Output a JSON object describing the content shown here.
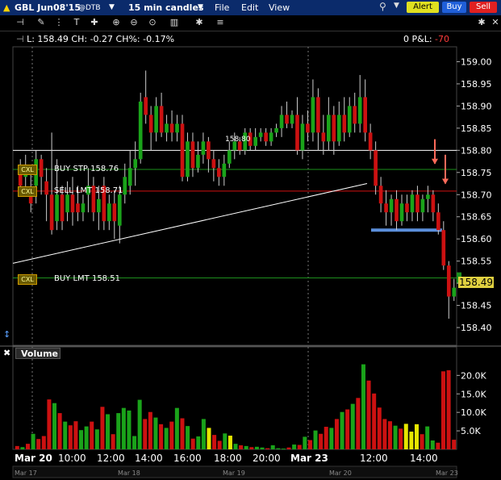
{
  "header": {
    "symbol": "GBL Jun08'15",
    "exchange": "@DTB",
    "timeframe": "15 min candles",
    "menu": [
      "File",
      "Edit",
      "View"
    ],
    "alert_label": "Alert",
    "buy_label": "Buy",
    "sell_label": "Sell"
  },
  "stats": {
    "text": "L: 158.49 CH: -0.27 CH%: -0.17%",
    "pnl_prefix": "0 P&L:",
    "pnl_value": "-70"
  },
  "orders": [
    {
      "tag": "CXL",
      "text": "BUY STP 158.76",
      "price": 158.76
    },
    {
      "tag": "CXL",
      "text": "SELL LMT 158.71",
      "price": 158.71
    },
    {
      "tag": "CXL",
      "text": "BUY LMT 158.51",
      "price": 158.51
    }
  ],
  "midline_label": "158.80",
  "last_price": "158.49",
  "volume_panel": {
    "label": "Volume"
  },
  "colors": {
    "up": "#1aa31a",
    "down": "#cc1111",
    "neutral": "#e6e600",
    "trendline": "#ffffff",
    "support": "#5b8fdc",
    "arrow": "#ff6a5a"
  },
  "chart_data": {
    "type": "candlestick",
    "price_axis": {
      "ticks": [
        "159.00",
        "158.95",
        "158.90",
        "158.85",
        "158.80",
        "158.75",
        "158.70",
        "158.65",
        "158.60",
        "158.55",
        "158.50",
        "158.45",
        "158.40"
      ],
      "ylim": [
        158.36,
        159.03
      ]
    },
    "volume_axis": {
      "ticks": [
        "20.0K",
        "15.0K",
        "10.0K",
        "5.0K"
      ],
      "ylim": [
        0,
        24000
      ]
    },
    "time_labels": [
      "Mar 20",
      "10:00",
      "12:00",
      "14:00",
      "16:00",
      "18:00",
      "20:00",
      "Mar 23",
      "12:00",
      "14:00"
    ],
    "scroll_labels": [
      "Mar 17",
      "Mar 18",
      "Mar 19",
      "Mar 20",
      "Mar 23"
    ],
    "candles": [
      {
        "o": 158.76,
        "c": 158.72,
        "h": 158.78,
        "l": 158.7
      },
      {
        "o": 158.74,
        "c": 158.76,
        "h": 158.79,
        "l": 158.7
      },
      {
        "o": 158.7,
        "c": 158.68,
        "h": 158.75,
        "l": 158.66
      },
      {
        "o": 158.72,
        "c": 158.78,
        "h": 158.8,
        "l": 158.68
      },
      {
        "o": 158.78,
        "c": 158.74,
        "h": 158.79,
        "l": 158.7
      },
      {
        "o": 158.73,
        "c": 158.7,
        "h": 158.76,
        "l": 158.64
      },
      {
        "o": 158.7,
        "c": 158.62,
        "h": 158.84,
        "l": 158.61
      },
      {
        "o": 158.64,
        "c": 158.7,
        "h": 158.78,
        "l": 158.62
      },
      {
        "o": 158.7,
        "c": 158.64,
        "h": 158.72,
        "l": 158.62
      },
      {
        "o": 158.66,
        "c": 158.7,
        "h": 158.73,
        "l": 158.64
      },
      {
        "o": 158.7,
        "c": 158.66,
        "h": 158.74,
        "l": 158.63
      },
      {
        "o": 158.68,
        "c": 158.66,
        "h": 158.72,
        "l": 158.64
      },
      {
        "o": 158.66,
        "c": 158.68,
        "h": 158.7,
        "l": 158.64
      },
      {
        "o": 158.7,
        "c": 158.72,
        "h": 158.76,
        "l": 158.66
      },
      {
        "o": 158.72,
        "c": 158.66,
        "h": 158.74,
        "l": 158.64
      },
      {
        "o": 158.66,
        "c": 158.69,
        "h": 158.72,
        "l": 158.62
      },
      {
        "o": 158.72,
        "c": 158.64,
        "h": 158.74,
        "l": 158.62
      },
      {
        "o": 158.64,
        "c": 158.68,
        "h": 158.7,
        "l": 158.62
      },
      {
        "o": 158.68,
        "c": 158.64,
        "h": 158.71,
        "l": 158.6
      },
      {
        "o": 158.63,
        "c": 158.7,
        "h": 158.72,
        "l": 158.59
      },
      {
        "o": 158.7,
        "c": 158.74,
        "h": 158.77,
        "l": 158.68
      },
      {
        "o": 158.72,
        "c": 158.76,
        "h": 158.8,
        "l": 158.7
      },
      {
        "o": 158.76,
        "c": 158.78,
        "h": 158.82,
        "l": 158.72
      },
      {
        "o": 158.78,
        "c": 158.91,
        "h": 158.93,
        "l": 158.77
      },
      {
        "o": 158.92,
        "c": 158.88,
        "h": 158.98,
        "l": 158.86
      },
      {
        "o": 158.88,
        "c": 158.84,
        "h": 158.9,
        "l": 158.8
      },
      {
        "o": 158.84,
        "c": 158.9,
        "h": 158.92,
        "l": 158.82
      },
      {
        "o": 158.9,
        "c": 158.84,
        "h": 158.93,
        "l": 158.83
      },
      {
        "o": 158.84,
        "c": 158.86,
        "h": 158.88,
        "l": 158.82
      },
      {
        "o": 158.86,
        "c": 158.84,
        "h": 158.89,
        "l": 158.82
      },
      {
        "o": 158.84,
        "c": 158.86,
        "h": 158.88,
        "l": 158.82
      },
      {
        "o": 158.86,
        "c": 158.74,
        "h": 158.88,
        "l": 158.73
      },
      {
        "o": 158.74,
        "c": 158.82,
        "h": 158.84,
        "l": 158.73
      },
      {
        "o": 158.82,
        "c": 158.76,
        "h": 158.84,
        "l": 158.74
      },
      {
        "o": 158.76,
        "c": 158.79,
        "h": 158.82,
        "l": 158.75
      },
      {
        "o": 158.79,
        "c": 158.82,
        "h": 158.84,
        "l": 158.77
      },
      {
        "o": 158.82,
        "c": 158.78,
        "h": 158.83,
        "l": 158.75
      },
      {
        "o": 158.78,
        "c": 158.76,
        "h": 158.8,
        "l": 158.73
      },
      {
        "o": 158.76,
        "c": 158.74,
        "h": 158.78,
        "l": 158.72
      },
      {
        "o": 158.74,
        "c": 158.77,
        "h": 158.79,
        "l": 158.72
      },
      {
        "o": 158.77,
        "c": 158.8,
        "h": 158.82,
        "l": 158.76
      },
      {
        "o": 158.8,
        "c": 158.82,
        "h": 158.84,
        "l": 158.78
      },
      {
        "o": 158.82,
        "c": 158.8,
        "h": 158.83,
        "l": 158.79
      },
      {
        "o": 158.8,
        "c": 158.84,
        "h": 158.85,
        "l": 158.79
      },
      {
        "o": 158.84,
        "c": 158.81,
        "h": 158.85,
        "l": 158.8
      },
      {
        "o": 158.81,
        "c": 158.83,
        "h": 158.85,
        "l": 158.8
      },
      {
        "o": 158.83,
        "c": 158.84,
        "h": 158.85,
        "l": 158.82
      },
      {
        "o": 158.84,
        "c": 158.82,
        "h": 158.85,
        "l": 158.81
      },
      {
        "o": 158.82,
        "c": 158.84,
        "h": 158.85,
        "l": 158.81
      },
      {
        "o": 158.84,
        "c": 158.85,
        "h": 158.86,
        "l": 158.83
      },
      {
        "o": 158.85,
        "c": 158.88,
        "h": 158.9,
        "l": 158.83
      },
      {
        "o": 158.88,
        "c": 158.86,
        "h": 158.91,
        "l": 158.85
      },
      {
        "o": 158.86,
        "c": 158.88,
        "h": 158.89,
        "l": 158.85
      },
      {
        "o": 158.88,
        "c": 158.8,
        "h": 158.92,
        "l": 158.79
      },
      {
        "o": 158.8,
        "c": 158.86,
        "h": 158.88,
        "l": 158.78
      },
      {
        "o": 158.86,
        "c": 158.84,
        "h": 158.89,
        "l": 158.82
      },
      {
        "o": 158.84,
        "c": 158.92,
        "h": 158.96,
        "l": 158.82
      },
      {
        "o": 158.92,
        "c": 158.84,
        "h": 158.94,
        "l": 158.8
      },
      {
        "o": 158.84,
        "c": 158.82,
        "h": 158.88,
        "l": 158.79
      },
      {
        "o": 158.82,
        "c": 158.88,
        "h": 158.92,
        "l": 158.8
      },
      {
        "o": 158.88,
        "c": 158.82,
        "h": 158.9,
        "l": 158.79
      },
      {
        "o": 158.82,
        "c": 158.88,
        "h": 158.91,
        "l": 158.81
      },
      {
        "o": 158.88,
        "c": 158.84,
        "h": 158.92,
        "l": 158.82
      },
      {
        "o": 158.84,
        "c": 158.9,
        "h": 158.92,
        "l": 158.83
      },
      {
        "o": 158.9,
        "c": 158.86,
        "h": 158.93,
        "l": 158.84
      },
      {
        "o": 158.86,
        "c": 158.92,
        "h": 158.97,
        "l": 158.84
      },
      {
        "o": 158.92,
        "c": 158.84,
        "h": 158.96,
        "l": 158.82
      },
      {
        "o": 158.84,
        "c": 158.8,
        "h": 158.86,
        "l": 158.78
      },
      {
        "o": 158.8,
        "c": 158.72,
        "h": 158.82,
        "l": 158.7
      },
      {
        "o": 158.72,
        "c": 158.68,
        "h": 158.74,
        "l": 158.66
      },
      {
        "o": 158.68,
        "c": 158.66,
        "h": 158.71,
        "l": 158.63
      },
      {
        "o": 158.66,
        "c": 158.69,
        "h": 158.7,
        "l": 158.63
      },
      {
        "o": 158.69,
        "c": 158.64,
        "h": 158.71,
        "l": 158.62
      },
      {
        "o": 158.64,
        "c": 158.68,
        "h": 158.7,
        "l": 158.63
      },
      {
        "o": 158.68,
        "c": 158.66,
        "h": 158.7,
        "l": 158.64
      },
      {
        "o": 158.66,
        "c": 158.7,
        "h": 158.71,
        "l": 158.64
      },
      {
        "o": 158.7,
        "c": 158.66,
        "h": 158.72,
        "l": 158.64
      },
      {
        "o": 158.66,
        "c": 158.69,
        "h": 158.7,
        "l": 158.64
      },
      {
        "o": 158.69,
        "c": 158.7,
        "h": 158.72,
        "l": 158.66
      },
      {
        "o": 158.7,
        "c": 158.66,
        "h": 158.71,
        "l": 158.64
      },
      {
        "o": 158.66,
        "c": 158.62,
        "h": 158.68,
        "l": 158.61
      },
      {
        "o": 158.62,
        "c": 158.54,
        "h": 158.64,
        "l": 158.53
      },
      {
        "o": 158.54,
        "c": 158.47,
        "h": 158.55,
        "l": 158.42
      },
      {
        "o": 158.47,
        "c": 158.49,
        "h": 158.51,
        "l": 158.46
      }
    ],
    "volume": [
      900,
      600,
      1500,
      4200,
      2800,
      3600,
      13500,
      12500,
      9800,
      7500,
      6500,
      7600,
      5200,
      6200,
      7500,
      5400,
      11500,
      9500,
      4100,
      9800,
      11200,
      10500,
      3600,
      13400,
      8200,
      10100,
      8600,
      6800,
      5800,
      7500,
      11200,
      8400,
      6300,
      2900,
      3500,
      8200,
      5800,
      3900,
      2300,
      4300,
      3700,
      1500,
      1100,
      900,
      600,
      700,
      500,
      300,
      1100,
      300,
      200,
      500,
      1300,
      1200,
      3400,
      2500,
      5100,
      4200,
      6100,
      5800,
      8200,
      10100,
      10800,
      12300,
      13900,
      23000,
      18600,
      15100,
      11300,
      8200,
      7600,
      6400,
      5600,
      6900,
      4800,
      6800,
      4100,
      6200,
      2400,
      1800,
      21100,
      21400,
      2600
    ]
  }
}
